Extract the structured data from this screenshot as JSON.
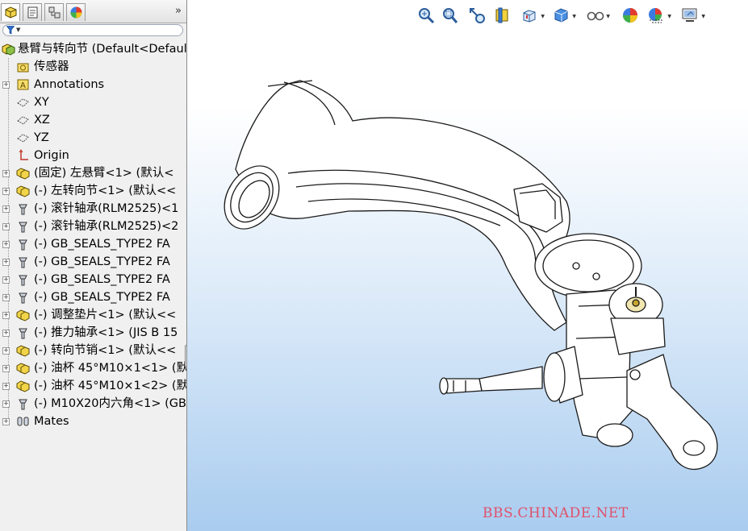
{
  "panel": {
    "tabs": [
      "feature-manager",
      "property-manager",
      "configuration-manager",
      "display-manager"
    ],
    "more_glyph": "»",
    "filter_icon": "funnel-icon",
    "root": {
      "label": "悬臂与转向节  (Default<Default",
      "icon": "assembly-icon"
    },
    "items": [
      {
        "label": "传感器",
        "icon": "sensor-folder-icon",
        "expandable": false
      },
      {
        "label": "Annotations",
        "icon": "annotations-icon",
        "expandable": true
      },
      {
        "label": "XY",
        "icon": "plane-icon",
        "expandable": false
      },
      {
        "label": "XZ",
        "icon": "plane-icon",
        "expandable": false
      },
      {
        "label": "YZ",
        "icon": "plane-icon",
        "expandable": false
      },
      {
        "label": "Origin",
        "icon": "origin-icon",
        "expandable": false
      },
      {
        "label": "(固定) 左悬臂<1> (默认<",
        "icon": "subassembly-icon",
        "expandable": true
      },
      {
        "label": "(-) 左转向节<1> (默认<<",
        "icon": "subassembly-icon",
        "expandable": true
      },
      {
        "label": "(-) 滚针轴承(RLM2525)<1",
        "icon": "part-icon",
        "expandable": true
      },
      {
        "label": "(-) 滚针轴承(RLM2525)<2",
        "icon": "part-icon",
        "expandable": true
      },
      {
        "label": "(-) GB_SEALS_TYPE2 FA",
        "icon": "part-icon",
        "expandable": true
      },
      {
        "label": "(-) GB_SEALS_TYPE2 FA",
        "icon": "part-icon",
        "expandable": true
      },
      {
        "label": "(-) GB_SEALS_TYPE2 FA",
        "icon": "part-icon",
        "expandable": true
      },
      {
        "label": "(-) GB_SEALS_TYPE2 FA",
        "icon": "part-icon",
        "expandable": true
      },
      {
        "label": "(-) 调整垫片<1> (默认<<",
        "icon": "subassembly-icon",
        "expandable": true
      },
      {
        "label": "(-) 推力轴承<1> (JIS B 15",
        "icon": "part-icon",
        "expandable": true
      },
      {
        "label": "(-) 转向节销<1> (默认<<",
        "icon": "subassembly-icon",
        "expandable": true
      },
      {
        "label": "(-) 油杯 45°M10×1<1> (默",
        "icon": "subassembly-icon",
        "expandable": true
      },
      {
        "label": "(-) 油杯 45°M10×1<2> (默",
        "icon": "subassembly-icon",
        "expandable": true
      },
      {
        "label": "(-) M10X20内六角<1> (GB",
        "icon": "part-icon",
        "expandable": true
      },
      {
        "label": "Mates",
        "icon": "mates-icon",
        "expandable": true
      }
    ]
  },
  "viewport": {
    "toolbar": [
      "zoom-to-fit-icon",
      "zoom-to-area-icon",
      "previous-view-icon",
      "section-view-icon",
      "view-orientation-icon",
      "display-style-icon",
      "hide-show-items-icon",
      "edit-appearance-icon",
      "apply-scene-icon",
      "view-settings-icon"
    ],
    "watermark": "BBS.CHINADE.NET",
    "model": "suspension-arm-and-steering-knuckle"
  },
  "colors": {
    "panel_bg": "#f0f0f0",
    "viewport_top": "#ffffff",
    "viewport_bottom": "#a9ccef",
    "watermark": "#e0506a",
    "model_fill": "#ffffff",
    "model_edge": "#1a1a1a"
  }
}
